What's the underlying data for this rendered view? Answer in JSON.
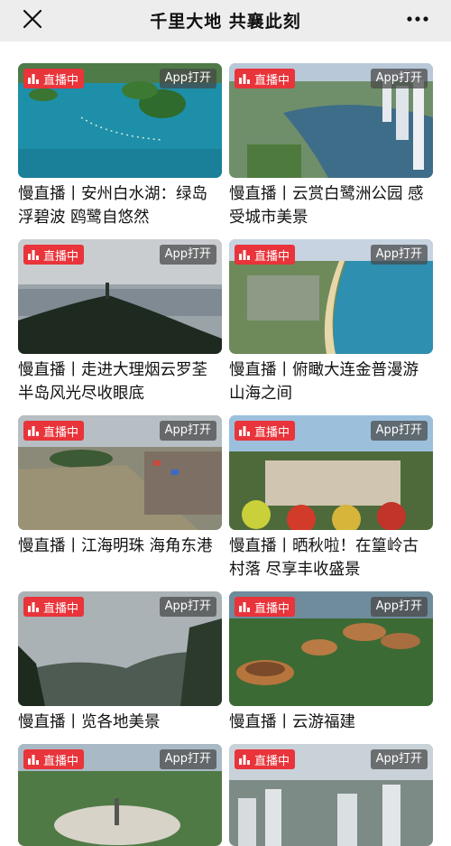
{
  "header": {
    "title": "千里大地 共襄此刻",
    "close_icon": "close-icon",
    "more_icon": "more-dots-icon"
  },
  "badges": {
    "live_label": "直播中",
    "app_label": "App打开",
    "live_color": "#e8343a"
  },
  "cards": [
    {
      "caption": "慢直播丨安州白水湖：绿岛浮碧波 鸥鹭自悠然"
    },
    {
      "caption": "慢直播丨云赏白鹭洲公园 感受城市美景"
    },
    {
      "caption": "慢直播丨走进大理烟云罗荃 半岛风光尽收眼底"
    },
    {
      "caption": "慢直播丨俯瞰大连金普漫游山海之间"
    },
    {
      "caption": "慢直播丨江海明珠 海角东港"
    },
    {
      "caption": "慢直播丨晒秋啦！在篁岭古村落 尽享丰收盛景"
    },
    {
      "caption": "慢直播丨览各地美景"
    },
    {
      "caption": "慢直播丨云游福建"
    },
    {
      "caption": ""
    },
    {
      "caption": ""
    }
  ]
}
